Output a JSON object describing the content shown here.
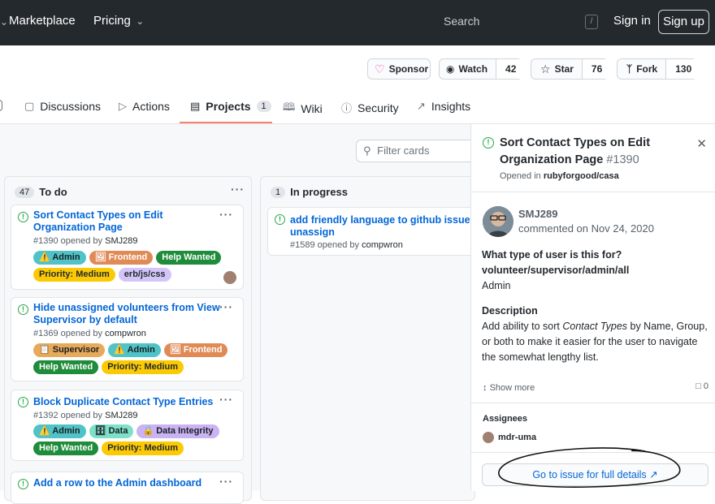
{
  "header": {
    "nav": [
      {
        "label": "Marketplace",
        "has_caret": false
      },
      {
        "label": "Pricing",
        "has_caret": true
      }
    ],
    "search_placeholder": "Search",
    "search_shortcut": "/",
    "signin": "Sign in",
    "signup": "Sign up"
  },
  "repo_actions": {
    "sponsor": "Sponsor",
    "watch": {
      "label": "Watch",
      "count": "42"
    },
    "star": {
      "label": "Star",
      "count": "76"
    },
    "fork": {
      "label": "Fork",
      "count": "130"
    }
  },
  "tabs": [
    {
      "label": "Discussions",
      "icon": "discussions-icon"
    },
    {
      "label": "Actions",
      "icon": "play-icon"
    },
    {
      "label": "Projects",
      "icon": "project-icon",
      "count": "1",
      "selected": true
    },
    {
      "label": "Wiki",
      "icon": "book-icon"
    },
    {
      "label": "Security",
      "icon": "shield-icon"
    },
    {
      "label": "Insights",
      "icon": "graph-icon"
    }
  ],
  "board": {
    "filter_placeholder": "Filter cards",
    "columns": [
      {
        "name": "To do",
        "count": "47",
        "cards": [
          {
            "title": "Sort Contact Types on Edit Organization Page",
            "number": "#1390",
            "opened_by_text": "opened by",
            "author": "SMJ289",
            "labels": [
              [
                "⚠️ Admin",
                "#4fc3c7",
                "#1b1f23"
              ],
              [
                "🖼 Frontend",
                "#e08a56",
                "#ffffff"
              ],
              [
                "Help Wanted",
                "#1e8c3a",
                "#ffffff"
              ],
              [
                "Priority: Medium",
                "#fbca04",
                "#24292e"
              ],
              [
                "erb/js/css",
                "#d4c5f9",
                "#24292e"
              ]
            ]
          },
          {
            "title": "Hide unassigned volunteers from View Supervisor by default",
            "number": "#1369",
            "opened_by_text": "opened by",
            "author": "compwron",
            "labels": [
              [
                "📋 Supervisor",
                "#e7a95a",
                "#1b1f23"
              ],
              [
                "⚠️ Admin",
                "#4fc3c7",
                "#1b1f23"
              ],
              [
                "🖼 Frontend",
                "#e08a56",
                "#ffffff"
              ],
              [
                "Help Wanted",
                "#1e8c3a",
                "#ffffff"
              ],
              [
                "Priority: Medium",
                "#fbca04",
                "#24292e"
              ]
            ]
          },
          {
            "title": "Block Duplicate Contact Type Entries",
            "number": "#1392",
            "opened_by_text": "opened by",
            "author": "SMJ289",
            "labels": [
              [
                "⚠️ Admin",
                "#4fc3c7",
                "#1b1f23"
              ],
              [
                "🗄 Data",
                "#7ee0c8",
                "#1b1f23"
              ],
              [
                "🔒 Data Integrity",
                "#c9b3f2",
                "#1b1f23"
              ],
              [
                "Help Wanted",
                "#1e8c3a",
                "#ffffff"
              ],
              [
                "Priority: Medium",
                "#fbca04",
                "#24292e"
              ]
            ]
          },
          {
            "title": "Add a row to the Admin dashboard"
          }
        ]
      },
      {
        "name": "In progress",
        "count": "1",
        "cards": [
          {
            "title": "add friendly language to github issue unassign",
            "number": "#1589",
            "opened_by_text": "opened by",
            "author": "compwron"
          }
        ]
      }
    ]
  },
  "panel": {
    "title": "Sort Contact Types on Edit Organization Page",
    "number": "#1390",
    "opened_in": "Opened in",
    "repo": "rubyforgood/casa",
    "author": "SMJ289",
    "commented": "commented on Nov 24, 2020",
    "q_heading": "What type of user is this for?",
    "q_options": "volunteer/supervisor/admin/all",
    "q_answer": "Admin",
    "desc_heading": "Description",
    "desc_before": "Add ability to sort ",
    "desc_em": "Contact Types",
    "desc_after": " by Name, Group, or both to make it easier for the user to navigate the somewhat lengthy list.",
    "show_more": "Show more",
    "comment_count": "0",
    "assignees_heading": "Assignees",
    "assignee": "mdr-uma",
    "goto": "Go to issue for full details"
  },
  "colors": {
    "accent_underline": "#f9826c",
    "link": "#0366d6",
    "open_issue": "#28a745"
  }
}
